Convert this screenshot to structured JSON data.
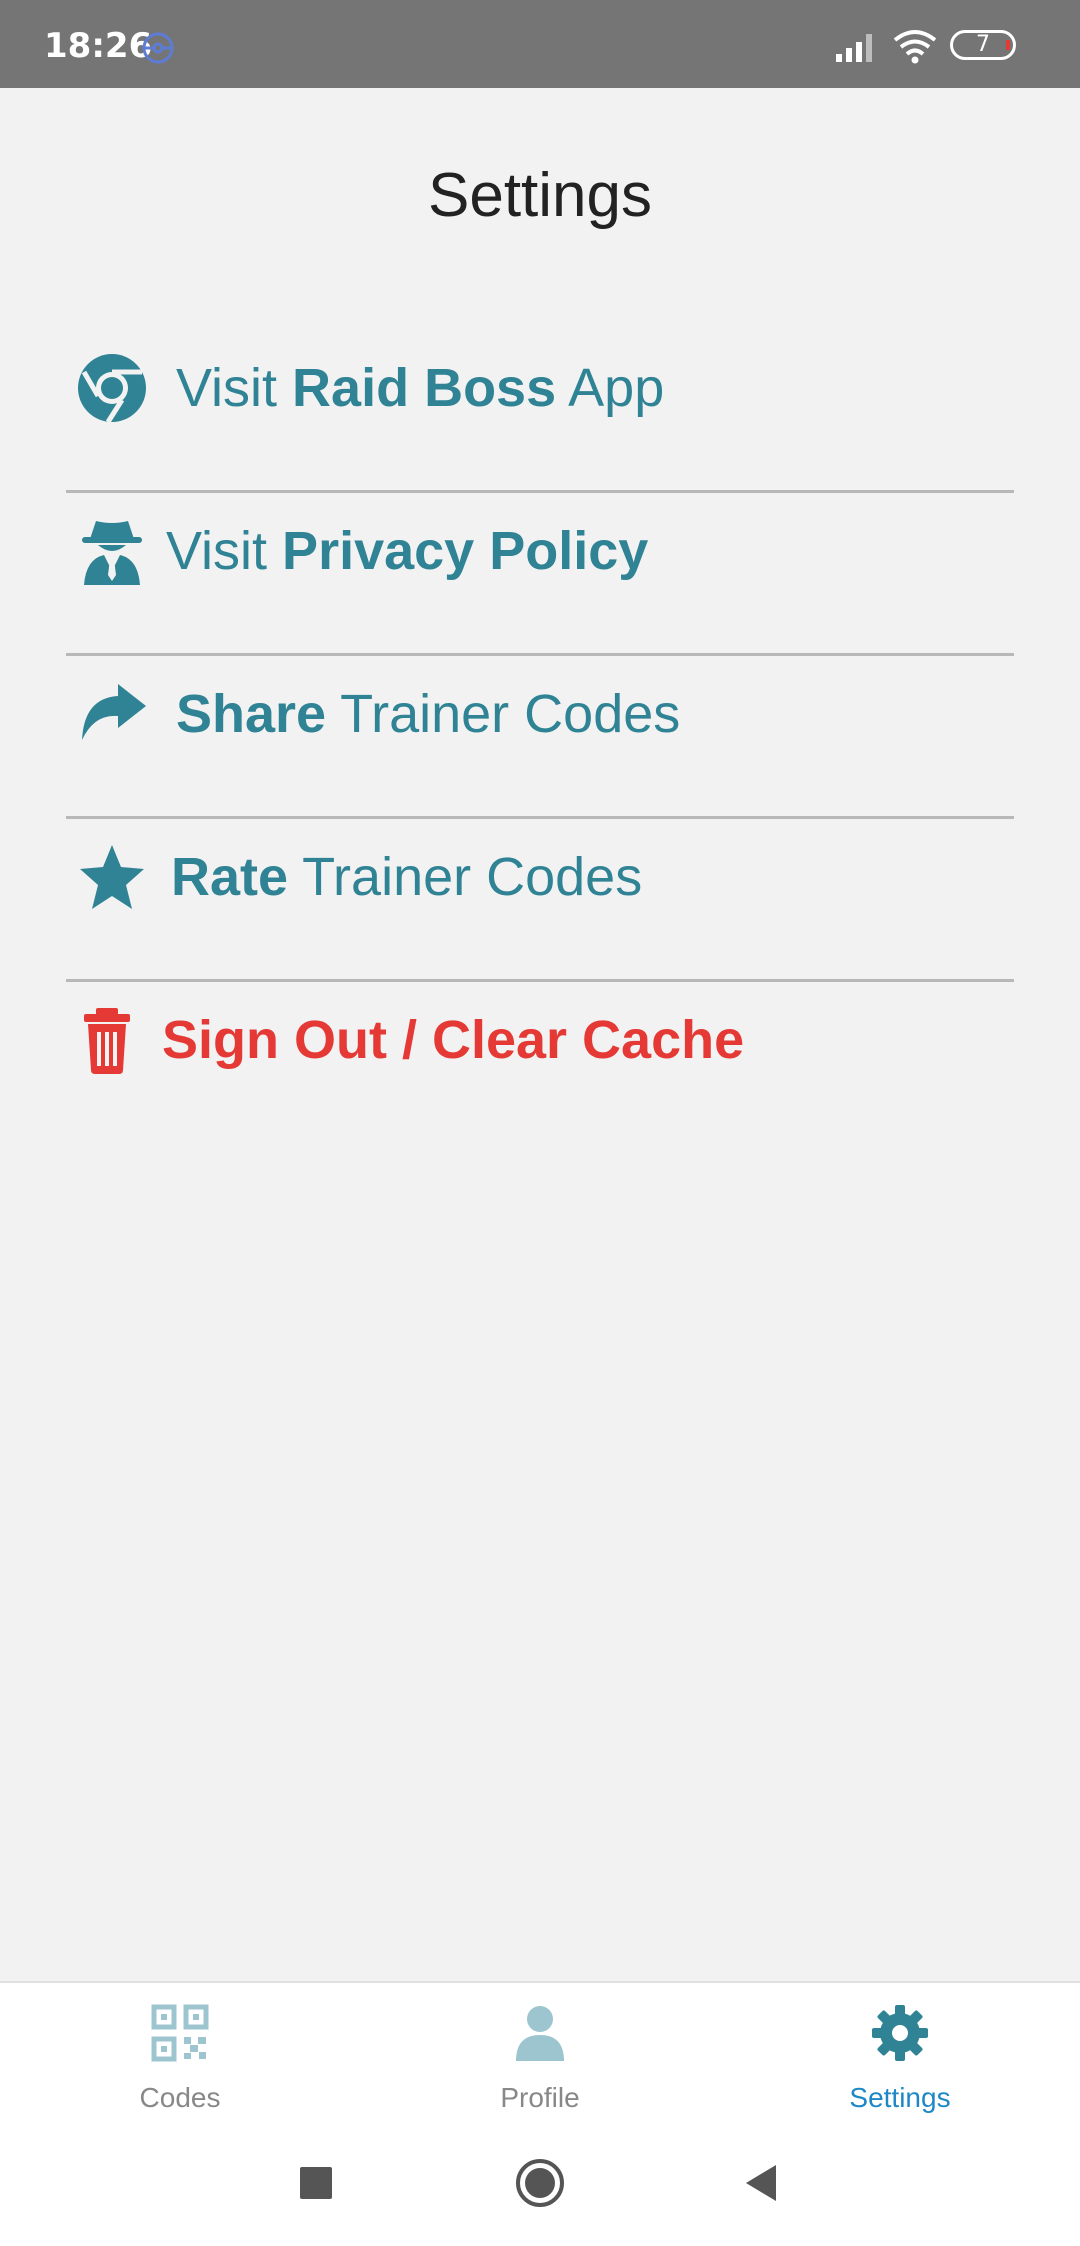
{
  "status_bar": {
    "time": "18:26",
    "battery_level": "7"
  },
  "page": {
    "title": "Settings"
  },
  "settings": {
    "items": [
      {
        "icon": "chrome-icon",
        "pre": "Visit ",
        "bold": "Raid Boss",
        "post": " App"
      },
      {
        "icon": "spy-icon",
        "pre": "Visit ",
        "bold": "Privacy Policy",
        "post": ""
      },
      {
        "icon": "share-icon",
        "pre": "",
        "bold": "Share",
        "post": " Trainer Codes"
      },
      {
        "icon": "star-icon",
        "pre": "",
        "bold": "Rate",
        "post": " Trainer Codes"
      },
      {
        "icon": "trash-icon",
        "pre": "",
        "bold": "Sign Out / Clear Cache",
        "post": ""
      }
    ]
  },
  "tabs": [
    {
      "label": "Codes",
      "icon": "qr-code-icon",
      "active": false
    },
    {
      "label": "Profile",
      "icon": "user-icon",
      "active": false
    },
    {
      "label": "Settings",
      "icon": "gear-icon",
      "active": true
    }
  ],
  "nav_bar": {
    "buttons": [
      "recents-square-icon",
      "home-circle-icon",
      "back-triangle-icon"
    ]
  },
  "colors": {
    "accent_teal": "#2f8394",
    "danger_red": "#e53935",
    "active_tab_blue": "#1e88c7",
    "inactive_tab_icon": "#9cc5cf",
    "status_bar_gray": "#757575"
  }
}
